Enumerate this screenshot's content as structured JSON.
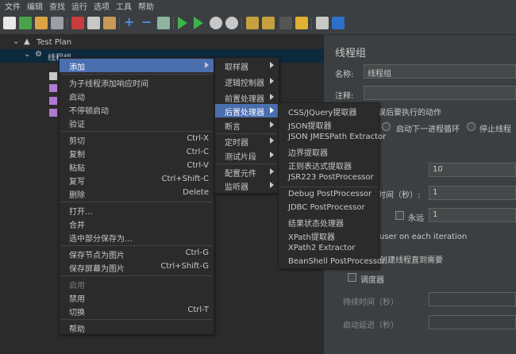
{
  "menubar": [
    "文件",
    "编辑",
    "查找",
    "运行",
    "选项",
    "工具",
    "帮助"
  ],
  "tree": {
    "test_plan": "Test Plan",
    "thread_group": "线程组"
  },
  "right": {
    "title": "线程组",
    "name_label": "名称:",
    "name_value": "线程组",
    "comment_label": "注释:",
    "error_action_label": "误后要执行的动作",
    "radio_next_loop": "启动下一进程循环",
    "radio_stop_thread": "停止线程",
    "threads_value": "10",
    "ramp_label": "时间（秒）:",
    "ramp_value": "1",
    "forever_label": "永远",
    "loop_value": "1",
    "same_user": "user on each iteration",
    "delay_create": "创建线程直到需要",
    "scheduler_label": "调度器",
    "duration_label": "持续时间（秒）",
    "startup_delay_label": "启动延迟（秒）"
  },
  "context_menu": {
    "items": [
      {
        "label": "添加",
        "submenu": true
      },
      {
        "label": "为子线程添加响应时间"
      },
      {
        "label": "启动"
      },
      {
        "label": "不停顿启动"
      },
      {
        "label": "验证"
      },
      {
        "label": "剪切",
        "accel": "Ctrl-X"
      },
      {
        "label": "复制",
        "accel": "Ctrl-C"
      },
      {
        "label": "粘贴",
        "accel": "Ctrl-V"
      },
      {
        "label": "复写",
        "accel": "Ctrl+Shift-C"
      },
      {
        "label": "删除",
        "accel": "Delete"
      },
      {
        "label": "打开..."
      },
      {
        "label": "合并"
      },
      {
        "label": "选中部分保存为..."
      },
      {
        "label": "保存节点为图片",
        "accel": "Ctrl-G"
      },
      {
        "label": "保存屏幕为图片",
        "accel": "Ctrl+Shift-G"
      },
      {
        "label": "启用",
        "disabled": true
      },
      {
        "label": "禁用"
      },
      {
        "label": "切换",
        "accel": "Ctrl-T"
      },
      {
        "label": "帮助"
      }
    ]
  },
  "add_submenu": {
    "items": [
      "取样器",
      "逻辑控制器",
      "前置处理器",
      "后置处理器",
      "断言",
      "定时器",
      "测试片段",
      "配置元件",
      "监听器"
    ]
  },
  "post_processor_submenu": {
    "items": [
      "CSS/JQuery提取器",
      "JSON提取器",
      "JSON JMESPath Extractor",
      "边界提取器",
      "正则表达式提取器",
      "JSR223 PostProcessor",
      "Debug PostProcessor",
      "JDBC PostProcessor",
      "结果状态处理器",
      "XPath提取器",
      "XPath2 Extractor",
      "BeanShell PostProcessor"
    ]
  },
  "colors": {
    "highlight": "#4b6eaf",
    "menu_bg": "#2b2b2b",
    "window_bg": "#3c3f41"
  }
}
